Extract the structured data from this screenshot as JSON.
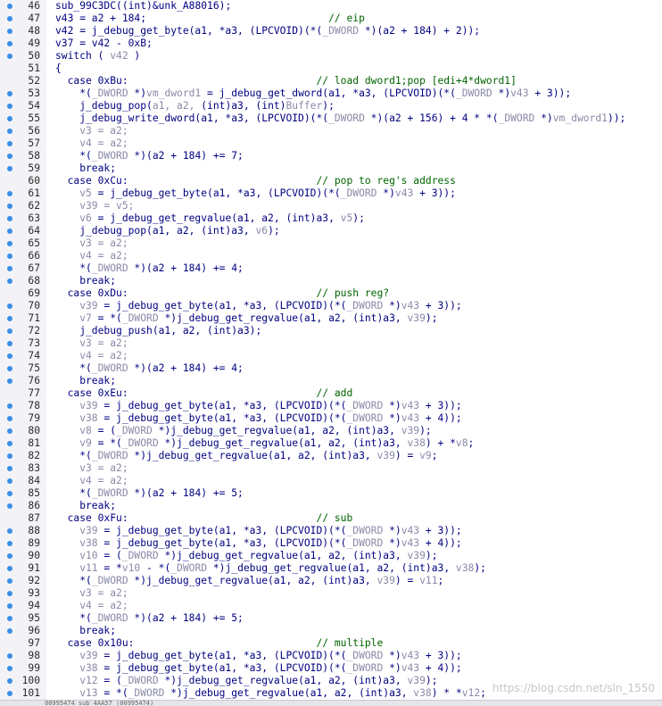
{
  "editor": {
    "lines": [
      {
        "n": "46",
        "bp": true,
        "segs": [
          [
            "c",
            "sub_99C3DC(("
          ],
          [
            "c",
            "int"
          ],
          [
            "c",
            ")&unk_A88016);"
          ]
        ]
      },
      {
        "n": "47",
        "bp": true,
        "segs": [
          [
            "c",
            "v43 = a2 + 184;"
          ],
          [
            "sp",
            30
          ],
          [
            "m",
            "// eip"
          ]
        ]
      },
      {
        "n": "48",
        "bp": true,
        "segs": [
          [
            "c",
            "v42 = j_debug_get_byte(a1, *a3, (LPCVOID)(*("
          ],
          [
            "v",
            "_DWORD"
          ],
          [
            "c",
            " *)(a2 + 184) + 2));"
          ]
        ]
      },
      {
        "n": "49",
        "bp": true,
        "segs": [
          [
            "c",
            "v37 = v42 - 0xB;"
          ]
        ]
      },
      {
        "n": "50",
        "bp": true,
        "segs": [
          [
            "c",
            "switch ( "
          ],
          [
            "v",
            "v42"
          ],
          [
            "c",
            " )"
          ]
        ]
      },
      {
        "n": "51",
        "bp": false,
        "segs": [
          [
            "c",
            "{"
          ]
        ]
      },
      {
        "n": "52",
        "bp": false,
        "segs": [
          [
            "c",
            "  case 0xBu:"
          ],
          [
            "sp",
            31
          ],
          [
            "m",
            "// load dword1;pop [edi+4*dword1]"
          ]
        ]
      },
      {
        "n": "53",
        "bp": true,
        "segs": [
          [
            "c",
            "    *("
          ],
          [
            "v",
            "_DWORD"
          ],
          [
            "c",
            " *)"
          ],
          [
            "v",
            "vm_dword1"
          ],
          [
            "c",
            " = j_debug_get_dword(a1, *a3, (LPCVOID)(*("
          ],
          [
            "v",
            "_DWORD"
          ],
          [
            "c",
            " *)"
          ],
          [
            "v",
            "v43"
          ],
          [
            "c",
            " + 3));"
          ]
        ]
      },
      {
        "n": "54",
        "bp": true,
        "segs": [
          [
            "c",
            "    j_debug_pop("
          ],
          [
            "v",
            "a1, a2, "
          ],
          [
            "c",
            "(int)a3, (int)"
          ],
          [
            "v",
            "Buffer"
          ],
          [
            "c",
            ");"
          ]
        ]
      },
      {
        "n": "55",
        "bp": true,
        "segs": [
          [
            "c",
            "    j_debug_write_dword(a1, *a3, (LPCVOID)(*("
          ],
          [
            "v",
            "_DWORD"
          ],
          [
            "c",
            " *)(a2 + 156) + 4 * *("
          ],
          [
            "v",
            "_DWORD"
          ],
          [
            "c",
            " *)"
          ],
          [
            "v",
            "vm_dword1"
          ],
          [
            "c",
            "));"
          ]
        ]
      },
      {
        "n": "56",
        "bp": true,
        "segs": [
          [
            "v",
            "    v3 = a2;"
          ]
        ]
      },
      {
        "n": "57",
        "bp": true,
        "segs": [
          [
            "v",
            "    v4 = a2;"
          ]
        ]
      },
      {
        "n": "58",
        "bp": true,
        "segs": [
          [
            "c",
            "    *("
          ],
          [
            "v",
            "_DWORD"
          ],
          [
            "c",
            " *)(a2 + 184) += 7;"
          ]
        ]
      },
      {
        "n": "59",
        "bp": true,
        "segs": [
          [
            "c",
            "    break;"
          ]
        ]
      },
      {
        "n": "60",
        "bp": false,
        "segs": [
          [
            "c",
            "  case 0xCu:"
          ],
          [
            "sp",
            31
          ],
          [
            "m",
            "// pop to reg's address"
          ]
        ]
      },
      {
        "n": "61",
        "bp": true,
        "segs": [
          [
            "v",
            "    v5"
          ],
          [
            "c",
            " = j_debug_get_byte(a1, *a3, (LPCVOID)(*("
          ],
          [
            "v",
            "_DWORD"
          ],
          [
            "c",
            " *)"
          ],
          [
            "v",
            "v43"
          ],
          [
            "c",
            " + 3));"
          ]
        ]
      },
      {
        "n": "62",
        "bp": true,
        "segs": [
          [
            "v",
            "    v39 = v5;"
          ]
        ]
      },
      {
        "n": "63",
        "bp": true,
        "segs": [
          [
            "v",
            "    v6"
          ],
          [
            "c",
            " = j_debug_get_regvalue(a1, a2, (int)a3, "
          ],
          [
            "v",
            "v5"
          ],
          [
            "c",
            ");"
          ]
        ]
      },
      {
        "n": "64",
        "bp": true,
        "segs": [
          [
            "c",
            "    j_debug_pop(a1, a2, (int)a3, "
          ],
          [
            "v",
            "v6"
          ],
          [
            "c",
            ");"
          ]
        ]
      },
      {
        "n": "65",
        "bp": true,
        "segs": [
          [
            "v",
            "    v3 = a2;"
          ]
        ]
      },
      {
        "n": "66",
        "bp": true,
        "segs": [
          [
            "v",
            "    v4 = a2;"
          ]
        ]
      },
      {
        "n": "67",
        "bp": true,
        "segs": [
          [
            "c",
            "    *("
          ],
          [
            "v",
            "_DWORD"
          ],
          [
            "c",
            " *)(a2 + 184) += 4;"
          ]
        ]
      },
      {
        "n": "68",
        "bp": true,
        "segs": [
          [
            "c",
            "    break;"
          ]
        ]
      },
      {
        "n": "69",
        "bp": false,
        "segs": [
          [
            "c",
            "  case 0xDu:"
          ],
          [
            "sp",
            31
          ],
          [
            "m",
            "// push reg?"
          ]
        ]
      },
      {
        "n": "70",
        "bp": true,
        "segs": [
          [
            "v",
            "    v39"
          ],
          [
            "c",
            " = j_debug_get_byte(a1, *a3, (LPCVOID)(*("
          ],
          [
            "v",
            "_DWORD"
          ],
          [
            "c",
            " *)"
          ],
          [
            "v",
            "v43"
          ],
          [
            "c",
            " + 3));"
          ]
        ]
      },
      {
        "n": "71",
        "bp": true,
        "segs": [
          [
            "v",
            "    v7"
          ],
          [
            "c",
            " = *("
          ],
          [
            "v",
            "_DWORD"
          ],
          [
            "c",
            " *)j_debug_get_regvalue(a1, a2, (int)a3, "
          ],
          [
            "v",
            "v39"
          ],
          [
            "c",
            ");"
          ]
        ]
      },
      {
        "n": "72",
        "bp": true,
        "segs": [
          [
            "c",
            "    j_debug_push(a1, a2, (int)a3);"
          ]
        ]
      },
      {
        "n": "73",
        "bp": true,
        "segs": [
          [
            "v",
            "    v3 = a2;"
          ]
        ]
      },
      {
        "n": "74",
        "bp": true,
        "segs": [
          [
            "v",
            "    v4 = a2;"
          ]
        ]
      },
      {
        "n": "75",
        "bp": true,
        "segs": [
          [
            "c",
            "    *("
          ],
          [
            "v",
            "_DWORD"
          ],
          [
            "c",
            " *)(a2 + 184) += 4;"
          ]
        ]
      },
      {
        "n": "76",
        "bp": true,
        "segs": [
          [
            "c",
            "    break;"
          ]
        ]
      },
      {
        "n": "77",
        "bp": false,
        "segs": [
          [
            "c",
            "  case 0xEu:"
          ],
          [
            "sp",
            31
          ],
          [
            "m",
            "// add"
          ]
        ]
      },
      {
        "n": "78",
        "bp": true,
        "segs": [
          [
            "v",
            "    v39"
          ],
          [
            "c",
            " = j_debug_get_byte(a1, *a3, (LPCVOID)(*("
          ],
          [
            "v",
            "_DWORD"
          ],
          [
            "c",
            " *)"
          ],
          [
            "v",
            "v43"
          ],
          [
            "c",
            " + 3));"
          ]
        ]
      },
      {
        "n": "79",
        "bp": true,
        "segs": [
          [
            "v",
            "    v38"
          ],
          [
            "c",
            " = j_debug_get_byte(a1, *a3, (LPCVOID)(*("
          ],
          [
            "v",
            "_DWORD"
          ],
          [
            "c",
            " *)"
          ],
          [
            "v",
            "v43"
          ],
          [
            "c",
            " + 4));"
          ]
        ]
      },
      {
        "n": "80",
        "bp": true,
        "segs": [
          [
            "v",
            "    v8"
          ],
          [
            "c",
            " = ("
          ],
          [
            "v",
            "_DWORD"
          ],
          [
            "c",
            " *)j_debug_get_regvalue(a1, a2, (int)a3, "
          ],
          [
            "v",
            "v39"
          ],
          [
            "c",
            ");"
          ]
        ]
      },
      {
        "n": "81",
        "bp": true,
        "segs": [
          [
            "v",
            "    v9"
          ],
          [
            "c",
            " = *("
          ],
          [
            "v",
            "_DWORD"
          ],
          [
            "c",
            " *)j_debug_get_regvalue(a1, a2, (int)a3, "
          ],
          [
            "v",
            "v38"
          ],
          [
            "c",
            ") + *"
          ],
          [
            "v",
            "v8"
          ],
          [
            "c",
            ";"
          ]
        ]
      },
      {
        "n": "82",
        "bp": true,
        "segs": [
          [
            "c",
            "    *("
          ],
          [
            "v",
            "_DWORD"
          ],
          [
            "c",
            " *)j_debug_get_regvalue(a1, a2, (int)a3, "
          ],
          [
            "v",
            "v39"
          ],
          [
            "c",
            ") = "
          ],
          [
            "v",
            "v9"
          ],
          [
            "c",
            ";"
          ]
        ]
      },
      {
        "n": "83",
        "bp": true,
        "segs": [
          [
            "v",
            "    v3 = a2;"
          ]
        ]
      },
      {
        "n": "84",
        "bp": true,
        "segs": [
          [
            "v",
            "    v4 = a2;"
          ]
        ]
      },
      {
        "n": "85",
        "bp": true,
        "segs": [
          [
            "c",
            "    *("
          ],
          [
            "v",
            "_DWORD"
          ],
          [
            "c",
            " *)(a2 + 184) += 5;"
          ]
        ]
      },
      {
        "n": "86",
        "bp": true,
        "segs": [
          [
            "c",
            "    break;"
          ]
        ]
      },
      {
        "n": "87",
        "bp": false,
        "segs": [
          [
            "c",
            "  case 0xFu:"
          ],
          [
            "sp",
            31
          ],
          [
            "m",
            "// sub"
          ]
        ]
      },
      {
        "n": "88",
        "bp": true,
        "segs": [
          [
            "v",
            "    v39"
          ],
          [
            "c",
            " = j_debug_get_byte(a1, *a3, (LPCVOID)(*("
          ],
          [
            "v",
            "_DWORD"
          ],
          [
            "c",
            " *)"
          ],
          [
            "v",
            "v43"
          ],
          [
            "c",
            " + 3));"
          ]
        ]
      },
      {
        "n": "89",
        "bp": true,
        "segs": [
          [
            "v",
            "    v38"
          ],
          [
            "c",
            " = j_debug_get_byte(a1, *a3, (LPCVOID)(*("
          ],
          [
            "v",
            "_DWORD"
          ],
          [
            "c",
            " *)"
          ],
          [
            "v",
            "v43"
          ],
          [
            "c",
            " + 4));"
          ]
        ]
      },
      {
        "n": "90",
        "bp": true,
        "segs": [
          [
            "v",
            "    v10"
          ],
          [
            "c",
            " = ("
          ],
          [
            "v",
            "_DWORD"
          ],
          [
            "c",
            " *)j_debug_get_regvalue(a1, a2, (int)a3, "
          ],
          [
            "v",
            "v39"
          ],
          [
            "c",
            ");"
          ]
        ]
      },
      {
        "n": "91",
        "bp": true,
        "segs": [
          [
            "v",
            "    v11"
          ],
          [
            "c",
            " = *"
          ],
          [
            "v",
            "v10"
          ],
          [
            "c",
            " - *("
          ],
          [
            "v",
            "_DWORD"
          ],
          [
            "c",
            " *)j_debug_get_regvalue(a1, a2, (int)a3, "
          ],
          [
            "v",
            "v38"
          ],
          [
            "c",
            ");"
          ]
        ]
      },
      {
        "n": "92",
        "bp": true,
        "segs": [
          [
            "c",
            "    *("
          ],
          [
            "v",
            "_DWORD"
          ],
          [
            "c",
            " *)j_debug_get_regvalue(a1, a2, (int)a3, "
          ],
          [
            "v",
            "v39"
          ],
          [
            "c",
            ") = "
          ],
          [
            "v",
            "v11"
          ],
          [
            "c",
            ";"
          ]
        ]
      },
      {
        "n": "93",
        "bp": true,
        "segs": [
          [
            "v",
            "    v3 = a2;"
          ]
        ]
      },
      {
        "n": "94",
        "bp": true,
        "segs": [
          [
            "v",
            "    v4 = a2;"
          ]
        ]
      },
      {
        "n": "95",
        "bp": true,
        "segs": [
          [
            "c",
            "    *("
          ],
          [
            "v",
            "_DWORD"
          ],
          [
            "c",
            " *)(a2 + 184) += 5;"
          ]
        ]
      },
      {
        "n": "96",
        "bp": true,
        "segs": [
          [
            "c",
            "    break;"
          ]
        ]
      },
      {
        "n": "97",
        "bp": false,
        "segs": [
          [
            "c",
            "  case 0x10u:"
          ],
          [
            "sp",
            30
          ],
          [
            "m",
            "// multiple"
          ]
        ]
      },
      {
        "n": "98",
        "bp": true,
        "segs": [
          [
            "v",
            "    v39"
          ],
          [
            "c",
            " = j_debug_get_byte(a1, *a3, (LPCVOID)(*("
          ],
          [
            "v",
            "_DWORD"
          ],
          [
            "c",
            " *)"
          ],
          [
            "v",
            "v43"
          ],
          [
            "c",
            " + 3));"
          ]
        ]
      },
      {
        "n": "99",
        "bp": true,
        "segs": [
          [
            "v",
            "    v38"
          ],
          [
            "c",
            " = j_debug_get_byte(a1, *a3, (LPCVOID)(*("
          ],
          [
            "v",
            "_DWORD"
          ],
          [
            "c",
            " *)"
          ],
          [
            "v",
            "v43"
          ],
          [
            "c",
            " + 4));"
          ]
        ]
      },
      {
        "n": "100",
        "bp": true,
        "segs": [
          [
            "v",
            "    v12"
          ],
          [
            "c",
            " = ("
          ],
          [
            "v",
            "_DWORD"
          ],
          [
            "c",
            " *)j_debug_get_regvalue(a1, a2, (int)a3, "
          ],
          [
            "v",
            "v39"
          ],
          [
            "c",
            ");"
          ]
        ]
      },
      {
        "n": "101",
        "bp": true,
        "segs": [
          [
            "v",
            "    v13"
          ],
          [
            "c",
            " = *("
          ],
          [
            "v",
            "_DWORD"
          ],
          [
            "c",
            " *)j_debug_get_regvalue(a1, a2, (int)a3, "
          ],
          [
            "v",
            "v38"
          ],
          [
            "c",
            ") * *"
          ],
          [
            "v",
            "v12"
          ],
          [
            "c",
            ";"
          ]
        ]
      }
    ]
  },
  "watermark": "https://blog.csdn.net/sln_1550",
  "status": "00995474  sub_4AA57 (00995474)",
  "colors": {
    "code": "#000080",
    "variable": "#8a8aa8",
    "comment": "#006400",
    "breakpoint_dot": "#3a8ee6"
  }
}
